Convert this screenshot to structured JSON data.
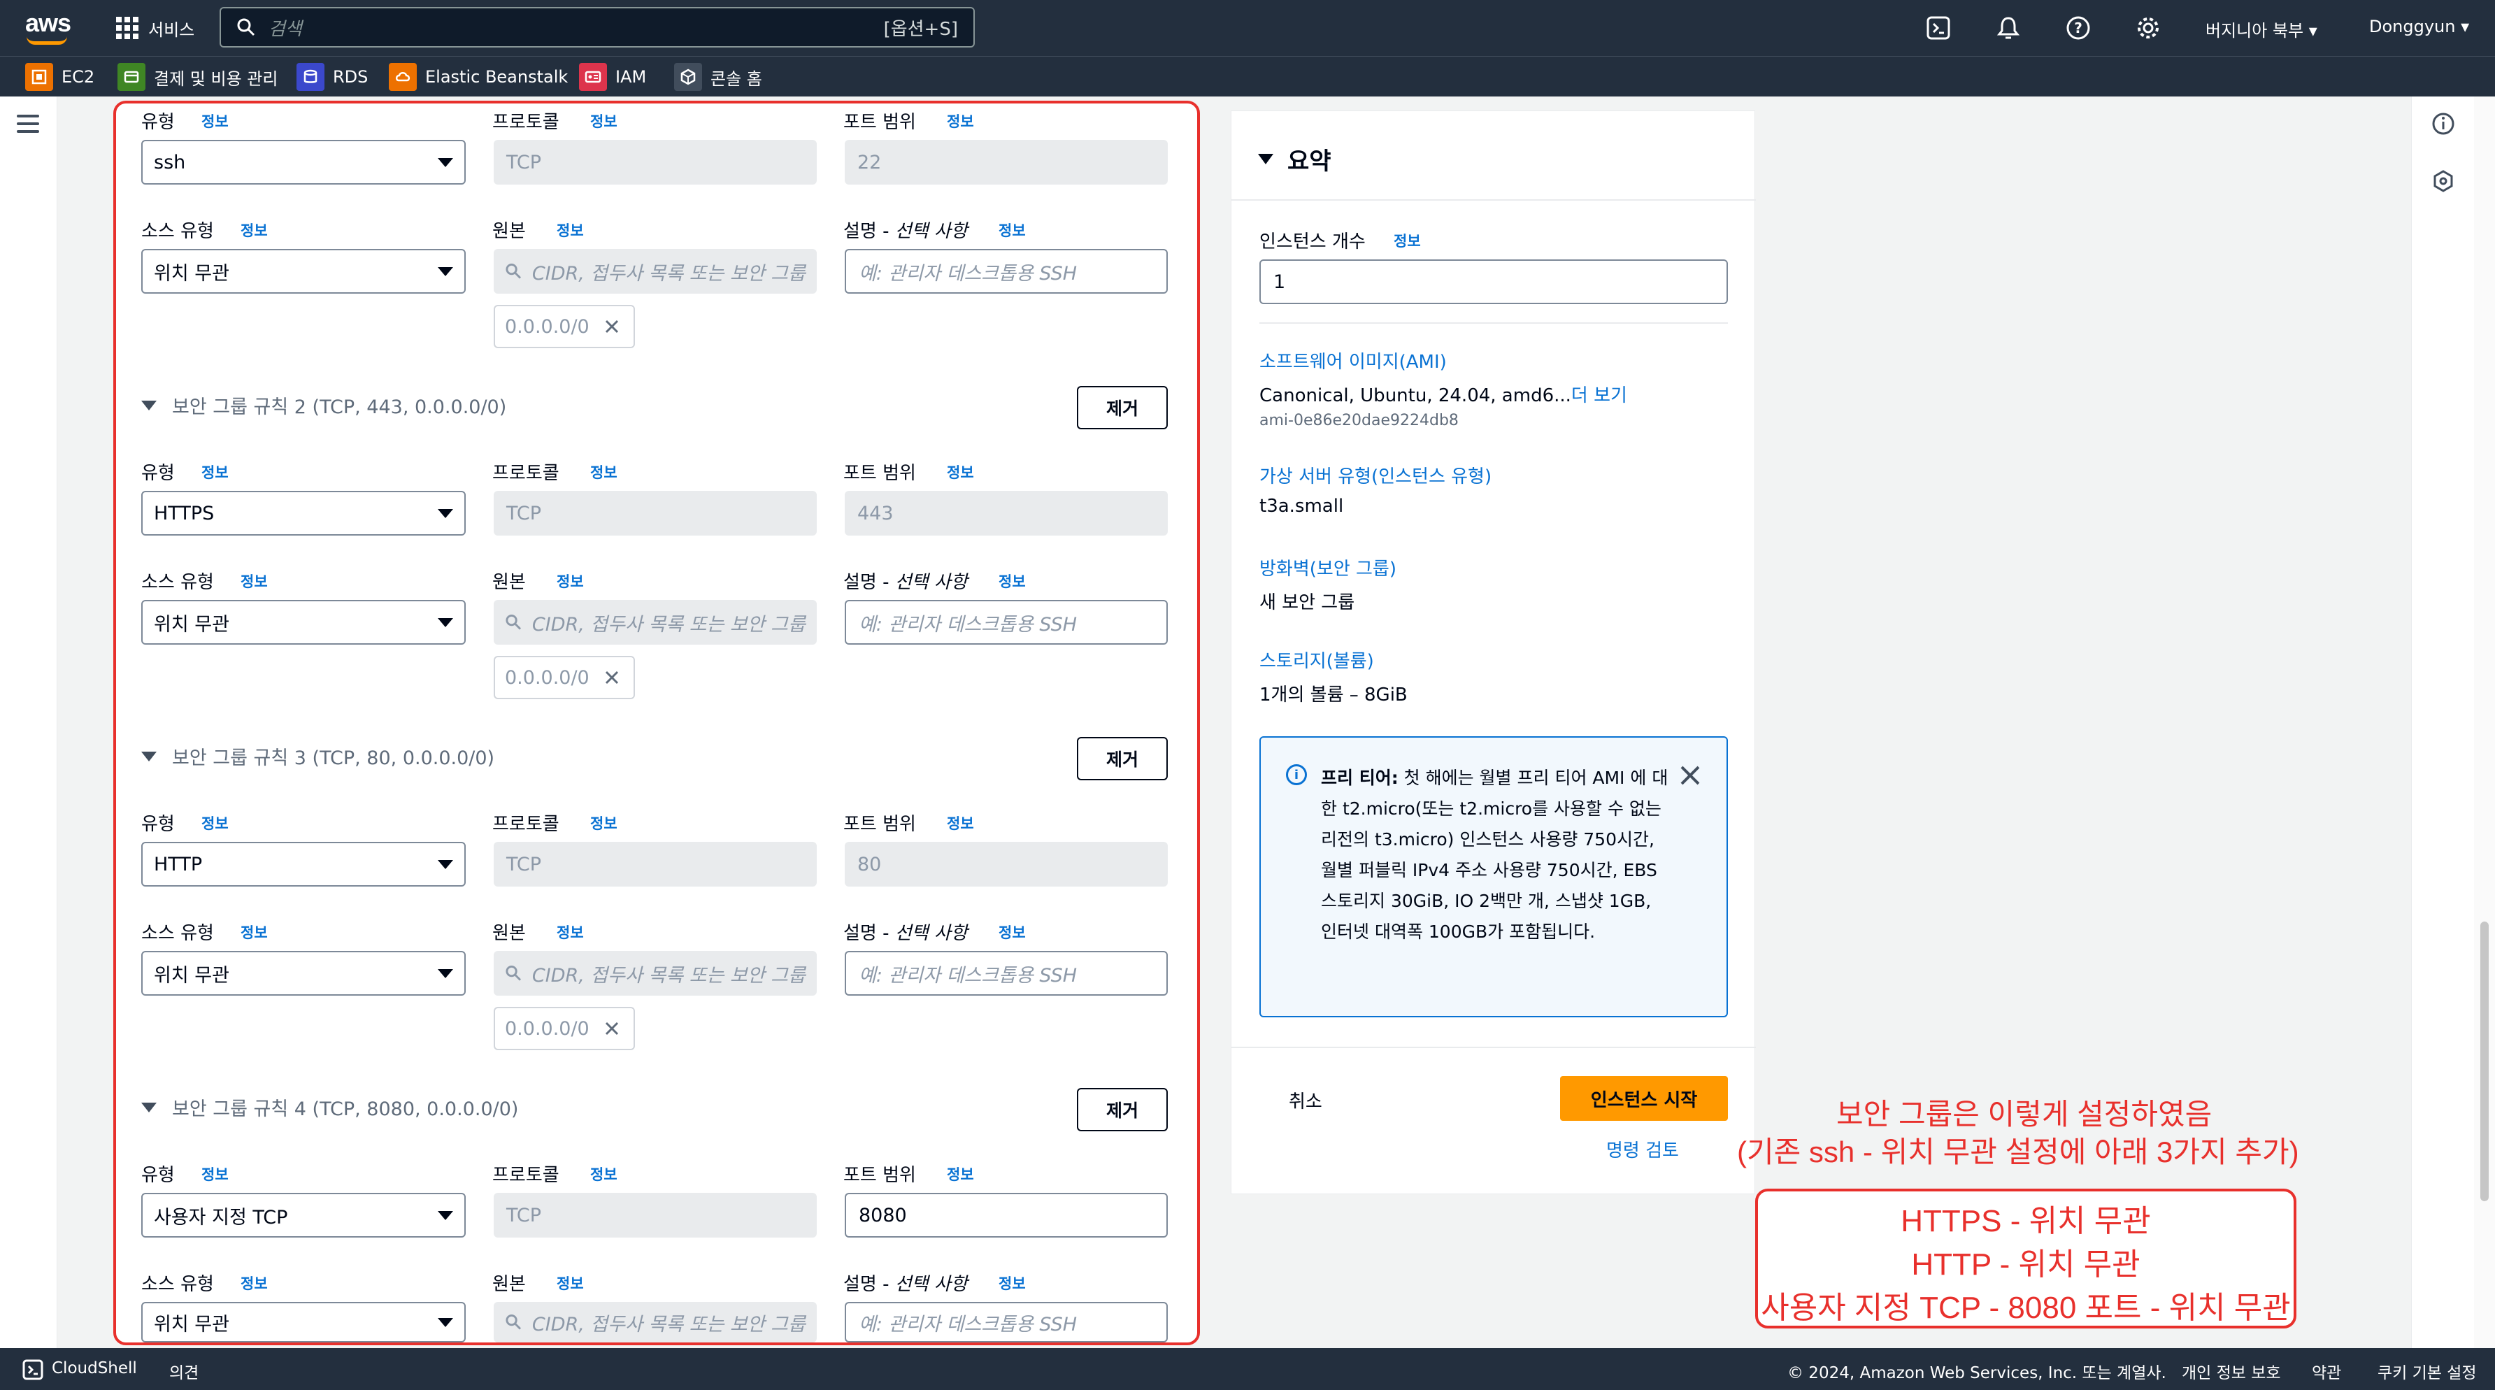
{
  "topnav": {
    "logo": "aws",
    "services_label": "서비스",
    "search_placeholder": "검색",
    "search_shortcut": "[옵션+S]",
    "region": "버지니아 북부",
    "user": "Donggyun"
  },
  "favorites": [
    {
      "label": "EC2",
      "icon": "ec2-icon",
      "color": "#ed7100"
    },
    {
      "label": "결제 및 비용 관리",
      "icon": "billing-icon",
      "color": "#3f8624"
    },
    {
      "label": "RDS",
      "icon": "rds-icon",
      "color": "#3b48cc"
    },
    {
      "label": "Elastic Beanstalk",
      "icon": "beanstalk-icon",
      "color": "#ed7100"
    },
    {
      "label": "IAM",
      "icon": "iam-icon",
      "color": "#dd344c"
    },
    {
      "label": "콘솔 홈",
      "icon": "console-home-icon",
      "color": "#414d5c"
    }
  ],
  "common": {
    "type_label": "유형",
    "protocol_label": "프로토콜",
    "port_label": "포트 범위",
    "source_type_label": "소스 유형",
    "source_label": "원본",
    "desc_label_main": "설명 - ",
    "desc_label_opt": "선택 사항",
    "info": "정보",
    "source_placeholder": "CIDR, 접두사 목록 또는 보안 그룹",
    "desc_placeholder": "예: 관리자 데스크톱용 SSH",
    "remove": "제거"
  },
  "rules": [
    {
      "header": "",
      "type": "ssh",
      "protocol": "TCP",
      "port": "22",
      "port_editable": false,
      "source_type": "위치 무관",
      "cidr": "0.0.0.0/0"
    },
    {
      "header": "보안 그룹 규칙 2 (TCP, 443, 0.0.0.0/0)",
      "type": "HTTPS",
      "protocol": "TCP",
      "port": "443",
      "port_editable": false,
      "source_type": "위치 무관",
      "cidr": "0.0.0.0/0"
    },
    {
      "header": "보안 그룹 규칙 3 (TCP, 80, 0.0.0.0/0)",
      "type": "HTTP",
      "protocol": "TCP",
      "port": "80",
      "port_editable": false,
      "source_type": "위치 무관",
      "cidr": "0.0.0.0/0"
    },
    {
      "header": "보안 그룹 규칙 4 (TCP, 8080, 0.0.0.0/0)",
      "type": "사용자 지정 TCP",
      "protocol": "TCP",
      "port": "8080",
      "port_editable": true,
      "source_type": "위치 무관",
      "cidr": ""
    }
  ],
  "summary": {
    "title": "요약",
    "instance_count_label": "인스턴스 개수",
    "instance_count": "1",
    "ami_link": "소프트웨어 이미지(AMI)",
    "ami_value": "Canonical, Ubuntu, 24.04, amd6...",
    "ami_more": "더 보기",
    "ami_id": "ami-0e86e20dae9224db8",
    "instance_type_link": "가상 서버 유형(인스턴스 유형)",
    "instance_type": "t3a.small",
    "firewall_link": "방화벽(보안 그룹)",
    "firewall_value": "새 보안 그룹",
    "storage_link": "스토리지(볼륨)",
    "storage_value": "1개의 볼륨 – 8GiB",
    "free_tier_bold": "프리 티어:",
    "free_tier_text": " 첫 해에는 월별 프리 티어 AMI 에 대한 t2.micro(또는 t2.micro를 사용할 수 없는 리전의 t3.micro) 인스턴스 사용량 750시간, 월별 퍼블릭 IPv4 주소 사용량 750시간, EBS 스토리지 30GiB, IO 2백만 개, 스냅샷 1GB, 인터넷 대역폭 100GB가 포함됩니다.",
    "cancel": "취소",
    "launch": "인스턴스 시작",
    "review": "명령 검토"
  },
  "annotation": {
    "line1": "보안 그룹은 이렇게 설정하였음",
    "line2": "(기존 ssh - 위치 무관 설정에 아래 3가지 추가)",
    "box": [
      "HTTPS - 위치 무관",
      "HTTP - 위치 무관",
      "사용자 지정 TCP - 8080 포트 - 위치 무관"
    ],
    "color": "#e8302c"
  },
  "footer": {
    "cloudshell": "CloudShell",
    "feedback": "의견",
    "copyright": "© 2024, Amazon Web Services, Inc. 또는 계열사.",
    "privacy": "개인 정보 보호",
    "terms": "약관",
    "cookies": "쿠키 기본 설정"
  }
}
